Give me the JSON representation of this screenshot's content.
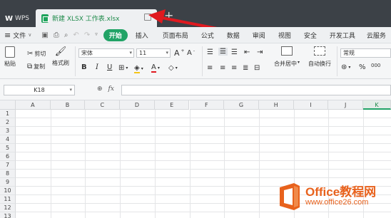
{
  "tabs": {
    "app_label": "WPS",
    "doc_label": "新建 XLSX 工作表.xlsx",
    "new_tab": "+"
  },
  "menubar": {
    "file": "文件",
    "items": [
      "开始",
      "插入",
      "页面布局",
      "公式",
      "数据",
      "审阅",
      "视图",
      "安全",
      "开发工具",
      "云服务"
    ],
    "active": "开始"
  },
  "ribbon": {
    "paste": "粘贴",
    "cut": "剪切",
    "copy": "复制",
    "format_painter": "格式刷",
    "font_name": "宋体",
    "font_size": "11",
    "grow": "A",
    "shrink": "A",
    "bold": "B",
    "italic": "I",
    "underline": "U",
    "merge_center": "合并居中",
    "wrap_text": "自动换行",
    "number_format": "常规",
    "percent": "%",
    "thousands": "000"
  },
  "formula_bar": {
    "name_box": "K18",
    "fx": "fx"
  },
  "grid": {
    "columns": [
      "A",
      "B",
      "C",
      "D",
      "E",
      "F",
      "G",
      "H",
      "I",
      "J",
      "K"
    ],
    "active_column": "K",
    "rows": [
      "1",
      "2",
      "3",
      "4",
      "5",
      "6",
      "7",
      "8",
      "9",
      "10",
      "11",
      "12",
      "13"
    ]
  },
  "watermark": {
    "title": "Office教程网",
    "url": "www.office26.com"
  },
  "colors": {
    "accent": "#21a366",
    "tabbar": "#3c4147",
    "annotation": "#e0191f",
    "watermark": "#e8621d"
  }
}
